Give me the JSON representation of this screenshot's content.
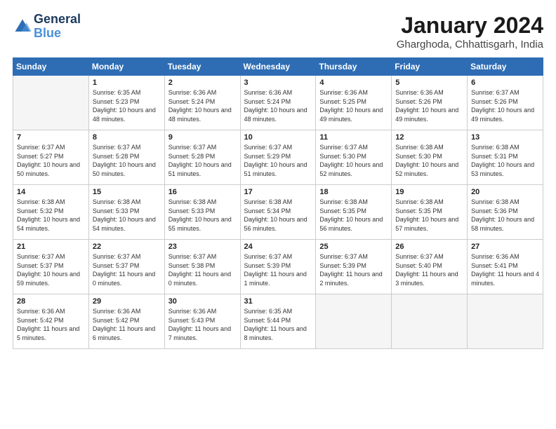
{
  "logo": {
    "line1": "General",
    "line2": "Blue"
  },
  "title": "January 2024",
  "subtitle": "Gharghoda, Chhattisgarh, India",
  "days_of_week": [
    "Sunday",
    "Monday",
    "Tuesday",
    "Wednesday",
    "Thursday",
    "Friday",
    "Saturday"
  ],
  "weeks": [
    [
      {
        "num": "",
        "empty": true
      },
      {
        "num": "1",
        "sunrise": "Sunrise: 6:35 AM",
        "sunset": "Sunset: 5:23 PM",
        "daylight": "Daylight: 10 hours and 48 minutes."
      },
      {
        "num": "2",
        "sunrise": "Sunrise: 6:36 AM",
        "sunset": "Sunset: 5:24 PM",
        "daylight": "Daylight: 10 hours and 48 minutes."
      },
      {
        "num": "3",
        "sunrise": "Sunrise: 6:36 AM",
        "sunset": "Sunset: 5:24 PM",
        "daylight": "Daylight: 10 hours and 48 minutes."
      },
      {
        "num": "4",
        "sunrise": "Sunrise: 6:36 AM",
        "sunset": "Sunset: 5:25 PM",
        "daylight": "Daylight: 10 hours and 49 minutes."
      },
      {
        "num": "5",
        "sunrise": "Sunrise: 6:36 AM",
        "sunset": "Sunset: 5:26 PM",
        "daylight": "Daylight: 10 hours and 49 minutes."
      },
      {
        "num": "6",
        "sunrise": "Sunrise: 6:37 AM",
        "sunset": "Sunset: 5:26 PM",
        "daylight": "Daylight: 10 hours and 49 minutes."
      }
    ],
    [
      {
        "num": "7",
        "sunrise": "Sunrise: 6:37 AM",
        "sunset": "Sunset: 5:27 PM",
        "daylight": "Daylight: 10 hours and 50 minutes."
      },
      {
        "num": "8",
        "sunrise": "Sunrise: 6:37 AM",
        "sunset": "Sunset: 5:28 PM",
        "daylight": "Daylight: 10 hours and 50 minutes."
      },
      {
        "num": "9",
        "sunrise": "Sunrise: 6:37 AM",
        "sunset": "Sunset: 5:28 PM",
        "daylight": "Daylight: 10 hours and 51 minutes."
      },
      {
        "num": "10",
        "sunrise": "Sunrise: 6:37 AM",
        "sunset": "Sunset: 5:29 PM",
        "daylight": "Daylight: 10 hours and 51 minutes."
      },
      {
        "num": "11",
        "sunrise": "Sunrise: 6:37 AM",
        "sunset": "Sunset: 5:30 PM",
        "daylight": "Daylight: 10 hours and 52 minutes."
      },
      {
        "num": "12",
        "sunrise": "Sunrise: 6:38 AM",
        "sunset": "Sunset: 5:30 PM",
        "daylight": "Daylight: 10 hours and 52 minutes."
      },
      {
        "num": "13",
        "sunrise": "Sunrise: 6:38 AM",
        "sunset": "Sunset: 5:31 PM",
        "daylight": "Daylight: 10 hours and 53 minutes."
      }
    ],
    [
      {
        "num": "14",
        "sunrise": "Sunrise: 6:38 AM",
        "sunset": "Sunset: 5:32 PM",
        "daylight": "Daylight: 10 hours and 54 minutes."
      },
      {
        "num": "15",
        "sunrise": "Sunrise: 6:38 AM",
        "sunset": "Sunset: 5:33 PM",
        "daylight": "Daylight: 10 hours and 54 minutes."
      },
      {
        "num": "16",
        "sunrise": "Sunrise: 6:38 AM",
        "sunset": "Sunset: 5:33 PM",
        "daylight": "Daylight: 10 hours and 55 minutes."
      },
      {
        "num": "17",
        "sunrise": "Sunrise: 6:38 AM",
        "sunset": "Sunset: 5:34 PM",
        "daylight": "Daylight: 10 hours and 56 minutes."
      },
      {
        "num": "18",
        "sunrise": "Sunrise: 6:38 AM",
        "sunset": "Sunset: 5:35 PM",
        "daylight": "Daylight: 10 hours and 56 minutes."
      },
      {
        "num": "19",
        "sunrise": "Sunrise: 6:38 AM",
        "sunset": "Sunset: 5:35 PM",
        "daylight": "Daylight: 10 hours and 57 minutes."
      },
      {
        "num": "20",
        "sunrise": "Sunrise: 6:38 AM",
        "sunset": "Sunset: 5:36 PM",
        "daylight": "Daylight: 10 hours and 58 minutes."
      }
    ],
    [
      {
        "num": "21",
        "sunrise": "Sunrise: 6:37 AM",
        "sunset": "Sunset: 5:37 PM",
        "daylight": "Daylight: 10 hours and 59 minutes."
      },
      {
        "num": "22",
        "sunrise": "Sunrise: 6:37 AM",
        "sunset": "Sunset: 5:37 PM",
        "daylight": "Daylight: 11 hours and 0 minutes."
      },
      {
        "num": "23",
        "sunrise": "Sunrise: 6:37 AM",
        "sunset": "Sunset: 5:38 PM",
        "daylight": "Daylight: 11 hours and 0 minutes."
      },
      {
        "num": "24",
        "sunrise": "Sunrise: 6:37 AM",
        "sunset": "Sunset: 5:39 PM",
        "daylight": "Daylight: 11 hours and 1 minute."
      },
      {
        "num": "25",
        "sunrise": "Sunrise: 6:37 AM",
        "sunset": "Sunset: 5:39 PM",
        "daylight": "Daylight: 11 hours and 2 minutes."
      },
      {
        "num": "26",
        "sunrise": "Sunrise: 6:37 AM",
        "sunset": "Sunset: 5:40 PM",
        "daylight": "Daylight: 11 hours and 3 minutes."
      },
      {
        "num": "27",
        "sunrise": "Sunrise: 6:36 AM",
        "sunset": "Sunset: 5:41 PM",
        "daylight": "Daylight: 11 hours and 4 minutes."
      }
    ],
    [
      {
        "num": "28",
        "sunrise": "Sunrise: 6:36 AM",
        "sunset": "Sunset: 5:42 PM",
        "daylight": "Daylight: 11 hours and 5 minutes."
      },
      {
        "num": "29",
        "sunrise": "Sunrise: 6:36 AM",
        "sunset": "Sunset: 5:42 PM",
        "daylight": "Daylight: 11 hours and 6 minutes."
      },
      {
        "num": "30",
        "sunrise": "Sunrise: 6:36 AM",
        "sunset": "Sunset: 5:43 PM",
        "daylight": "Daylight: 11 hours and 7 minutes."
      },
      {
        "num": "31",
        "sunrise": "Sunrise: 6:35 AM",
        "sunset": "Sunset: 5:44 PM",
        "daylight": "Daylight: 11 hours and 8 minutes."
      },
      {
        "num": "",
        "empty": true
      },
      {
        "num": "",
        "empty": true
      },
      {
        "num": "",
        "empty": true
      }
    ]
  ]
}
